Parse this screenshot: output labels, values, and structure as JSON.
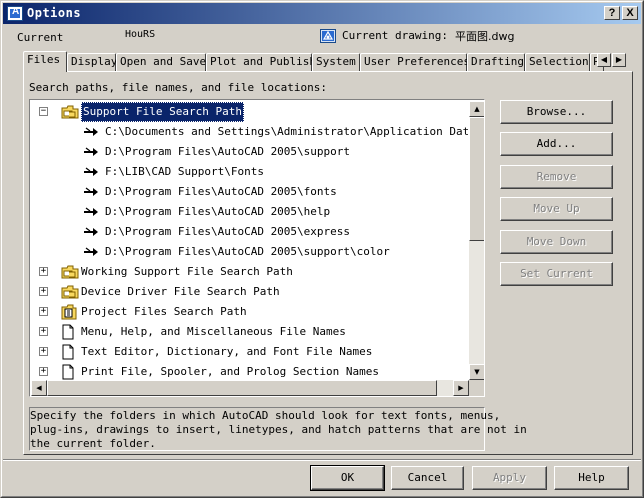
{
  "window": {
    "title": "Options"
  },
  "titlebar_buttons": {
    "help": "?",
    "close": "X"
  },
  "profile": {
    "label": "Current",
    "value": "HouRS"
  },
  "drawing": {
    "label": "Current drawing:",
    "value": "平面图.dwg",
    "icon": "drawing-file-icon"
  },
  "tabs": [
    {
      "label": "Files",
      "active": true
    },
    {
      "label": "Display"
    },
    {
      "label": "Open and Save"
    },
    {
      "label": "Plot and Publish"
    },
    {
      "label": "System"
    },
    {
      "label": "User Preferences"
    },
    {
      "label": "Drafting"
    },
    {
      "label": "Selection"
    },
    {
      "label": "P"
    }
  ],
  "tab_scroll": {
    "left": "◀",
    "right": "▶"
  },
  "search_label": "Search paths, file names, and file locations:",
  "tree": {
    "nodes": [
      {
        "expander": "−",
        "icon": "folder-support-icon",
        "label": "Support File Search Path",
        "selected": true,
        "level": 0
      },
      {
        "icon": "arrow-path-icon",
        "label": "C:\\Documents and Settings\\Administrator\\Application Data\\Autodesk",
        "level": 1
      },
      {
        "icon": "arrow-path-icon",
        "label": "D:\\Program Files\\AutoCAD 2005\\support",
        "level": 1
      },
      {
        "icon": "arrow-path-icon",
        "label": "F:\\LIB\\CAD Support\\Fonts",
        "level": 1
      },
      {
        "icon": "arrow-path-icon",
        "label": "D:\\Program Files\\AutoCAD 2005\\fonts",
        "level": 1
      },
      {
        "icon": "arrow-path-icon",
        "label": "D:\\Program Files\\AutoCAD 2005\\help",
        "level": 1
      },
      {
        "icon": "arrow-path-icon",
        "label": "D:\\Program Files\\AutoCAD 2005\\express",
        "level": 1
      },
      {
        "icon": "arrow-path-icon",
        "label": "D:\\Program Files\\AutoCAD 2005\\support\\color",
        "level": 1
      },
      {
        "expander": "+",
        "icon": "folder-support-icon",
        "label": "Working Support File Search Path",
        "level": 0
      },
      {
        "expander": "+",
        "icon": "folder-support-icon",
        "label": "Device Driver File Search Path",
        "level": 0
      },
      {
        "expander": "+",
        "icon": "project-files-icon",
        "label": "Project Files Search Path",
        "level": 0
      },
      {
        "expander": "+",
        "icon": "document-icon",
        "label": "Menu, Help, and Miscellaneous File Names",
        "level": 0
      },
      {
        "expander": "+",
        "icon": "document-icon",
        "label": "Text Editor, Dictionary, and Font File Names",
        "level": 0
      },
      {
        "expander": "+",
        "icon": "document-icon",
        "label": "Print File, Spooler, and Prolog Section Names",
        "level": 0
      }
    ]
  },
  "side_buttons": {
    "browse": "Browse...",
    "add": "Add...",
    "remove": "Remove",
    "move_up": "Move Up",
    "move_down": "Move Down",
    "set_current": "Set Current"
  },
  "description": "Specify the folders in which AutoCAD should look for text fonts, menus,\nplug-ins, drawings to insert, linetypes, and hatch patterns that are not in\nthe current folder.",
  "bottom_buttons": {
    "ok": "OK",
    "cancel": "Cancel",
    "apply": "Apply",
    "help": "Help"
  }
}
